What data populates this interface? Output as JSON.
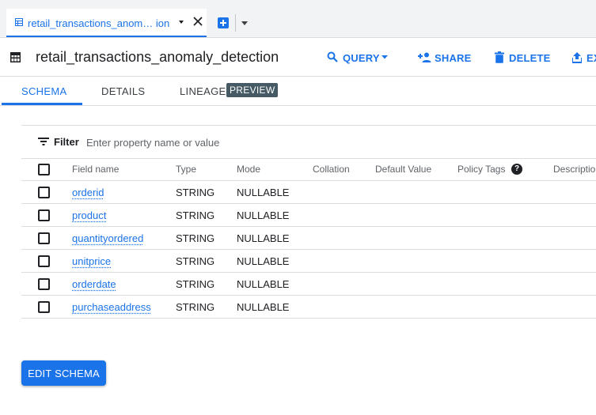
{
  "tab": {
    "label": "retail_transactions_anom… ion"
  },
  "header": {
    "title": "retail_transactions_anomaly_detection",
    "actions": {
      "query": "QUERY",
      "share": "SHARE",
      "delete": "DELETE",
      "export": "EX"
    }
  },
  "subtabs": {
    "schema": "SCHEMA",
    "details": "DETAILS",
    "lineage": "LINEAGE",
    "preview_badge": "PREVIEW"
  },
  "filter": {
    "label": "Filter",
    "placeholder": "Enter property name or value",
    "value": ""
  },
  "table": {
    "columns": [
      "Field name",
      "Type",
      "Mode",
      "Collation",
      "Default Value",
      "Policy Tags",
      "Descriptio"
    ],
    "rows": [
      {
        "name": "orderid",
        "type": "STRING",
        "mode": "NULLABLE"
      },
      {
        "name": "product",
        "type": "STRING",
        "mode": "NULLABLE"
      },
      {
        "name": "quantityordered",
        "type": "STRING",
        "mode": "NULLABLE"
      },
      {
        "name": "unitprice",
        "type": "STRING",
        "mode": "NULLABLE"
      },
      {
        "name": "orderdate",
        "type": "STRING",
        "mode": "NULLABLE"
      },
      {
        "name": "purchaseaddress",
        "type": "STRING",
        "mode": "NULLABLE"
      }
    ]
  },
  "edit_schema_button": "EDIT SCHEMA",
  "colors": {
    "accent": "#1a73e8",
    "badge": "#455a64",
    "border": "#dadce0"
  }
}
